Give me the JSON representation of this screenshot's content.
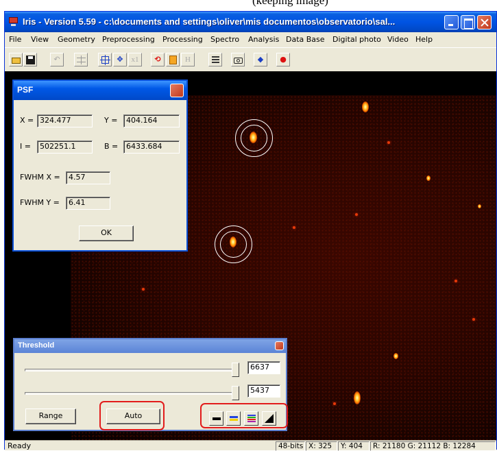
{
  "caption": "(keeping image)",
  "window": {
    "title": "Iris - Version 5.59 - c:\\documents and settings\\oliver\\mis documentos\\observatorio\\sal...",
    "app_icon": "monitor-icon",
    "controls": {
      "minimize": "minimize-icon",
      "maximize": "maximize-icon",
      "close": "close-icon"
    }
  },
  "menu": [
    "File",
    "View",
    "Geometry",
    "Preprocessing",
    "Processing",
    "Spectro",
    "Analysis",
    "Data Base",
    "Digital photo",
    "Video",
    "Help"
  ],
  "toolbar": {
    "icons": [
      "open-folder-icon",
      "save-disk-icon",
      "undo-icon",
      "levels-icon",
      "crosshair-square-icon",
      "move-crosshair-icon",
      "zoom-x1-icon",
      "rotate-icon",
      "notes-icon",
      "header-icon",
      "list-icon",
      "camera-icon",
      "blue-diamond-icon",
      "red-dot-icon"
    ],
    "x1_label": "x1",
    "h_label": "H"
  },
  "psf": {
    "title": "PSF",
    "x_label": "X =",
    "x_value": "324.477",
    "y_label": "Y =",
    "y_value": "404.164",
    "i_label": "I =",
    "i_value": "502251.1",
    "b_label": "B =",
    "b_value": "6433.684",
    "fwhmx_label": "FWHM X =",
    "fwhmx_value": "4.57",
    "fwhmy_label": "FWHM Y =",
    "fwhmy_value": "6.41",
    "ok_label": "OK"
  },
  "threshold": {
    "title": "Threshold",
    "high_value": "6637",
    "low_value": "5437",
    "range_label": "Range",
    "auto_label": "Auto",
    "palettes": [
      "grayscale-palette-icon",
      "blue-yellow-palette-icon",
      "rainbow-palette-icon",
      "negative-palette-icon"
    ]
  },
  "status": {
    "ready": "Ready",
    "bits": "48-bits",
    "x": "X: 325",
    "y": "Y: 404",
    "rgb": "R: 21180  G: 21112  B: 12284"
  }
}
